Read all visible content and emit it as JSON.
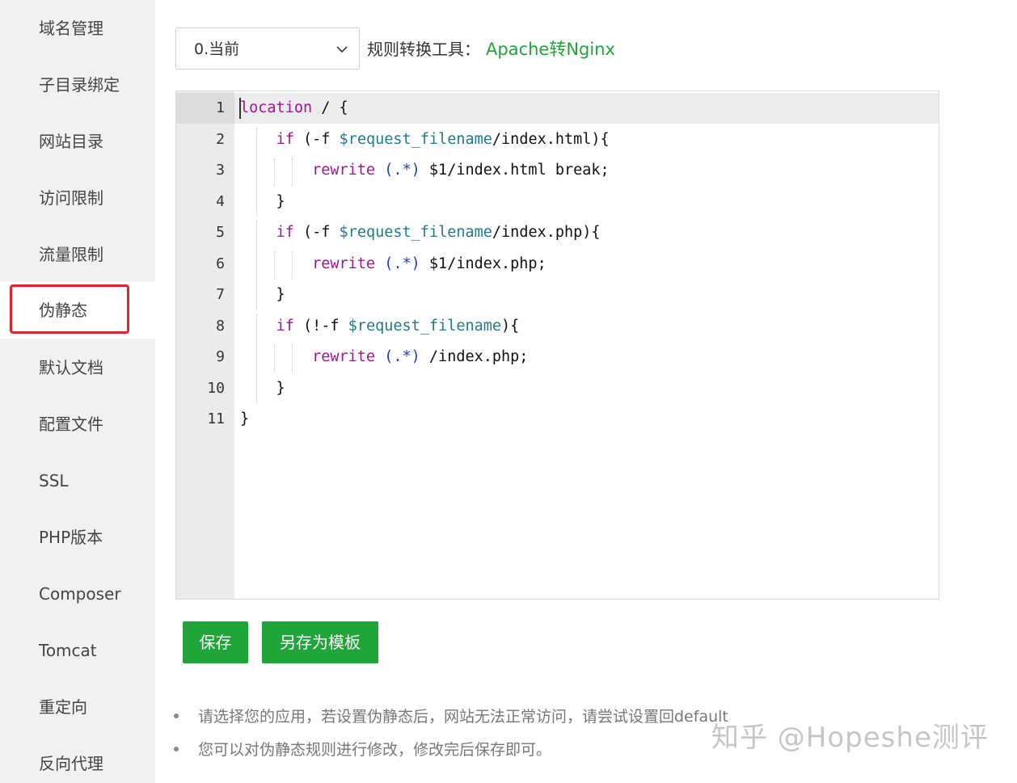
{
  "sidebar": {
    "items": [
      {
        "label": "域名管理"
      },
      {
        "label": "子目录绑定"
      },
      {
        "label": "网站目录"
      },
      {
        "label": "访问限制"
      },
      {
        "label": "流量限制"
      },
      {
        "label": "伪静态"
      },
      {
        "label": "默认文档"
      },
      {
        "label": "配置文件"
      },
      {
        "label": "SSL"
      },
      {
        "label": "PHP版本"
      },
      {
        "label": "Composer"
      },
      {
        "label": "Tomcat"
      },
      {
        "label": "重定向"
      },
      {
        "label": "反向代理"
      }
    ],
    "active_index": 5
  },
  "toolbar": {
    "select_value": "0.当前",
    "tool_label": "规则转换工具：",
    "tool_link": "Apache转Nginx"
  },
  "editor": {
    "line_numbers": [
      "1",
      "2",
      "3",
      "4",
      "5",
      "6",
      "7",
      "8",
      "9",
      "10",
      "11"
    ],
    "lines": [
      [
        {
          "t": "location",
          "c": "kw"
        },
        {
          "t": " / {",
          "c": ""
        }
      ],
      [
        {
          "t": "    ",
          "c": ""
        },
        {
          "t": "if",
          "c": "kw"
        },
        {
          "t": " (-f ",
          "c": ""
        },
        {
          "t": "$request_filename",
          "c": "var"
        },
        {
          "t": "/index.html){",
          "c": ""
        }
      ],
      [
        {
          "t": "        ",
          "c": ""
        },
        {
          "t": "rewrite",
          "c": "kw"
        },
        {
          "t": " ",
          "c": ""
        },
        {
          "t": "(.*)",
          "c": "rx"
        },
        {
          "t": " $1/index.html break;",
          "c": ""
        }
      ],
      [
        {
          "t": "    }",
          "c": ""
        }
      ],
      [
        {
          "t": "    ",
          "c": ""
        },
        {
          "t": "if",
          "c": "kw"
        },
        {
          "t": " (-f ",
          "c": ""
        },
        {
          "t": "$request_filename",
          "c": "var"
        },
        {
          "t": "/index.php){",
          "c": ""
        }
      ],
      [
        {
          "t": "        ",
          "c": ""
        },
        {
          "t": "rewrite",
          "c": "kw"
        },
        {
          "t": " ",
          "c": ""
        },
        {
          "t": "(.*)",
          "c": "rx"
        },
        {
          "t": " $1/index.php;",
          "c": ""
        }
      ],
      [
        {
          "t": "    }",
          "c": ""
        }
      ],
      [
        {
          "t": "    ",
          "c": ""
        },
        {
          "t": "if",
          "c": "kw"
        },
        {
          "t": " (!-f ",
          "c": ""
        },
        {
          "t": "$request_filename",
          "c": "var"
        },
        {
          "t": "){",
          "c": ""
        }
      ],
      [
        {
          "t": "        ",
          "c": ""
        },
        {
          "t": "rewrite",
          "c": "kw"
        },
        {
          "t": " ",
          "c": ""
        },
        {
          "t": "(.*)",
          "c": "rx"
        },
        {
          "t": " /index.php;",
          "c": ""
        }
      ],
      [
        {
          "t": "    }",
          "c": ""
        }
      ],
      [
        {
          "t": "}",
          "c": ""
        }
      ]
    ]
  },
  "buttons": {
    "save": "保存",
    "save_as_template": "另存为模板"
  },
  "notes": [
    "请选择您的应用，若设置伪静态后，网站无法正常访问，请尝试设置回default",
    "您可以对伪静态规则进行修改，修改完后保存即可。"
  ],
  "watermark": "知乎 @Hopeshe测评",
  "colors": {
    "accent": "#20a53a",
    "highlight": "#e0242b"
  }
}
